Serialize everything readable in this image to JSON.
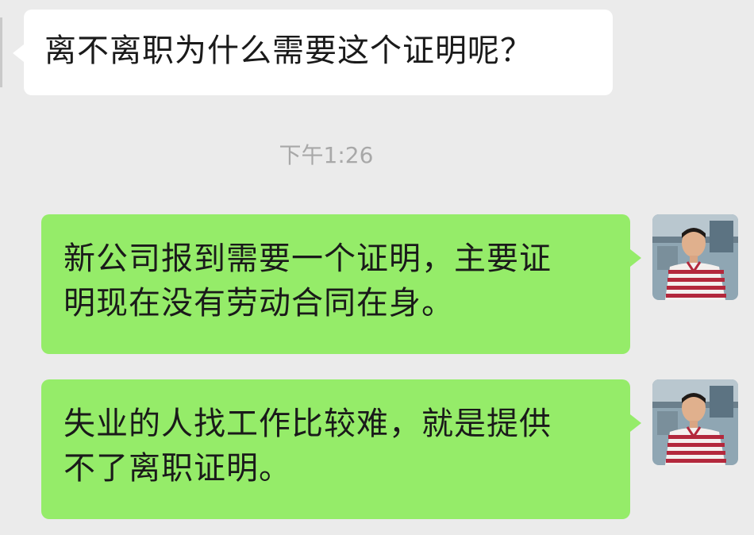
{
  "messages": [
    {
      "side": "received",
      "lines": [
        "离不离职为什么需要这个证明呢？"
      ]
    },
    {
      "side": "sent",
      "lines": [
        "新公司报到需要一个证明，主要证",
        "明现在没有劳动合同在身。"
      ]
    },
    {
      "side": "sent",
      "lines": [
        "失业的人找工作比较难，就是提供",
        "不了离职证明。"
      ]
    }
  ],
  "timestamp": "下午1:26",
  "colors": {
    "background": "#ebebeb",
    "received_bubble": "#ffffff",
    "sent_bubble": "#95ec69",
    "timestamp_text": "#a8a8a8"
  },
  "icons": {
    "avatar": "user-avatar-photo"
  }
}
